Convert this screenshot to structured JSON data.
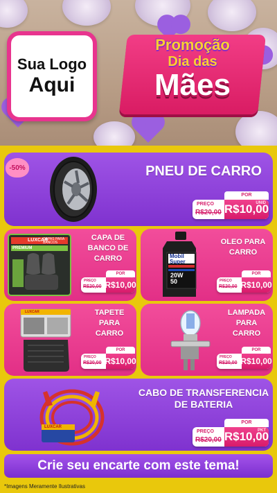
{
  "header": {
    "logo_line1": "Sua Logo",
    "logo_line2": "Aqui",
    "promo_title": "Promoção",
    "promo_subtitle": "Dia das",
    "promo_big": "Mães"
  },
  "discount_badge": "-50%",
  "labels": {
    "preco": "PREÇO",
    "por": "POR"
  },
  "products": [
    {
      "name": "PNEU DE CARRO",
      "old_price": "R$20,00",
      "new_price": "R$10,00",
      "unit": "UNID"
    },
    {
      "name": "CAPA DE BANCO DE CARRO",
      "old_price": "R$20,00",
      "new_price": "R$10,00",
      "unit": ""
    },
    {
      "name": "OLEO PARA CARRO",
      "old_price": "R$20,00",
      "new_price": "R$10,00",
      "unit": ""
    },
    {
      "name": "TAPETE PARA CARRO",
      "old_price": "R$20,00",
      "new_price": "R$10,00",
      "unit": ""
    },
    {
      "name": "LAMPADA PARA CARRO",
      "old_price": "R$20,00",
      "new_price": "R$10,00",
      "unit": ""
    },
    {
      "name": "CABO DE TRANSFERENCIA DE BATERIA",
      "old_price": "R$20,00",
      "new_price": "R$10,00",
      "unit": "PKT"
    }
  ],
  "product_art_text": {
    "seat_cover_brand": "LUXCAR",
    "seat_cover_box": "CAPAS PARA BANCOS",
    "seat_cover_tag": "PREMIUM",
    "oil_brand": "Mobil Super",
    "oil_grade": "20W 50",
    "mat_brand": "LUXCAR",
    "cable_brand": "LUXCAR"
  },
  "cta": "Crie seu encarte com este tema!",
  "footnote": "*Imagens Meramente Ilustrativas",
  "colors": {
    "purple": "#8a3ad8",
    "pink": "#e8348e",
    "yellow": "#e9c80c"
  }
}
